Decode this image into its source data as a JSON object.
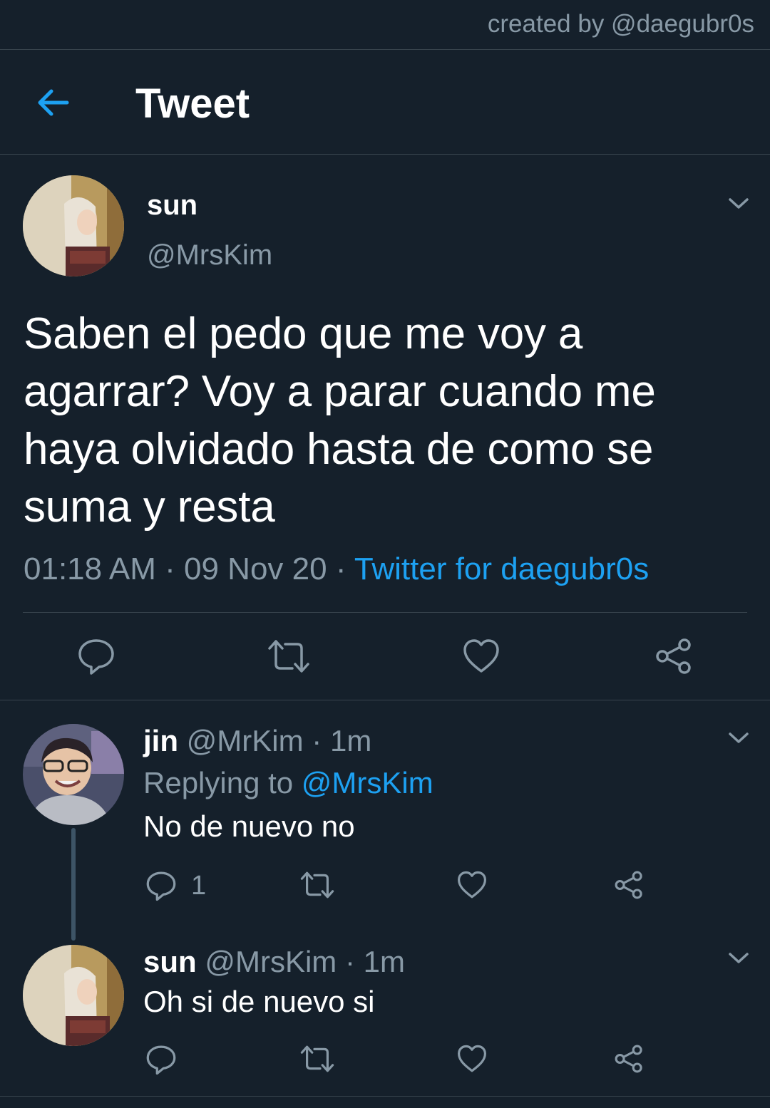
{
  "watermark": "created by @daegubr0s",
  "header": {
    "title": "Tweet",
    "back_icon": "arrow-left-icon"
  },
  "main_tweet": {
    "name": "sun",
    "handle": "@MrsKim",
    "text": "Saben el pedo que me voy a agarrar? Voy a parar cuando me haya olvidado hasta de como se suma y resta",
    "time": "01:18 AM",
    "date": "09 Nov 20",
    "separator": " · ",
    "source": "Twitter for daegubr0s",
    "actions": [
      "reply-icon",
      "retweet-icon",
      "like-icon",
      "share-icon"
    ]
  },
  "replies": [
    {
      "name": "jin",
      "handle": "@MrKim",
      "age": "1m",
      "replying_prefix": "Replying to ",
      "replying_to": "@MrsKim",
      "text": "No de nuevo no",
      "reply_count": "1"
    },
    {
      "name": "sun",
      "handle": "@MrsKim",
      "age": "1m",
      "text": "Oh si de nuevo si",
      "reply_count": ""
    }
  ],
  "colors": {
    "background": "#15202b",
    "accent": "#1da1f2",
    "muted": "#8899a6",
    "divider": "#38444d",
    "thread_line": "#3d5466"
  }
}
